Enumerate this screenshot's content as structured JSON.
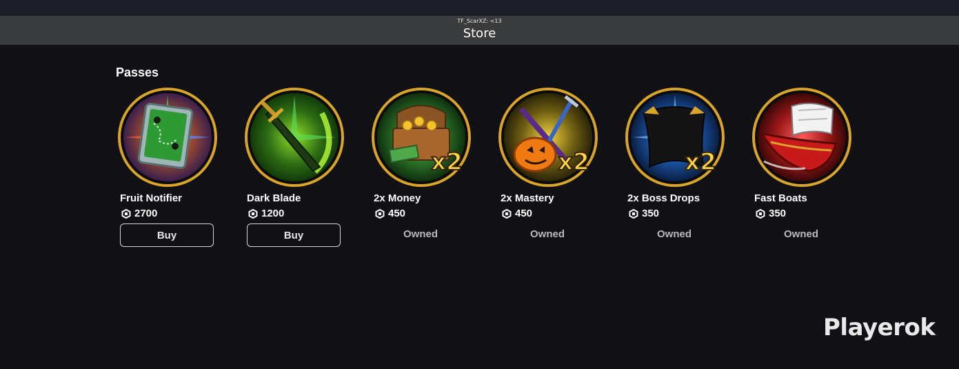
{
  "header": {
    "subtitle": "TF_ScarXZ: <13",
    "title": "Store"
  },
  "section": {
    "title": "Passes"
  },
  "passes": [
    {
      "name": "Fruit Notifier",
      "price": "2700",
      "action": "Buy",
      "icon": "map-card-icon",
      "accent": "#2fa532"
    },
    {
      "name": "Dark Blade",
      "price": "1200",
      "action": "Buy",
      "icon": "sword-icon",
      "accent": "#3a8a1c"
    },
    {
      "name": "2x Money",
      "price": "450",
      "action": "Owned",
      "icon": "treasure-chest-icon",
      "accent": "#2d7a2a"
    },
    {
      "name": "2x Mastery",
      "price": "450",
      "action": "Owned",
      "icon": "pumpkin-swords-icon",
      "accent": "#7a6a12"
    },
    {
      "name": "2x Boss Drops",
      "price": "350",
      "action": "Owned",
      "icon": "captain-hat-icon",
      "accent": "#1f5fb0"
    },
    {
      "name": "Fast Boats",
      "price": "350",
      "action": "Owned",
      "icon": "ship-icon",
      "accent": "#a01a1a"
    }
  ],
  "badge": "x2",
  "watermark": "Playerok"
}
